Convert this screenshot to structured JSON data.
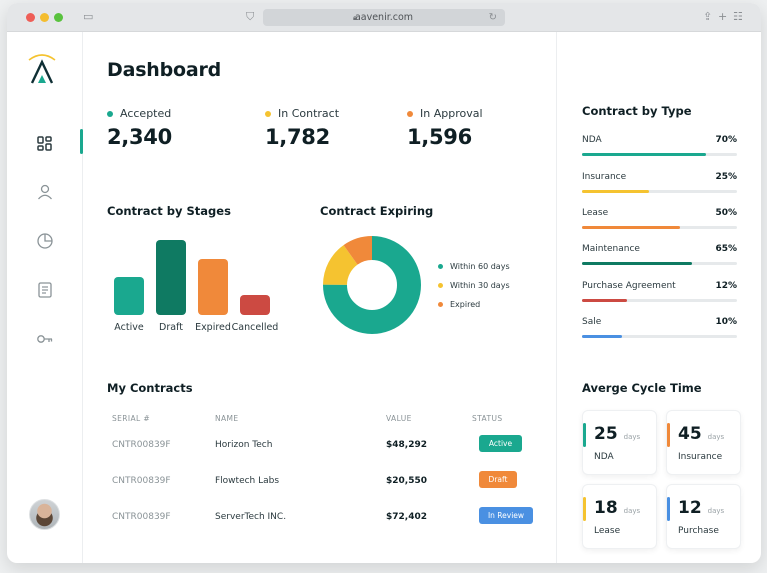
{
  "browser": {
    "url": "aavenir.com"
  },
  "page": {
    "title": "Dashboard"
  },
  "stats": [
    {
      "label": "Accepted",
      "value": "2,340",
      "color": "#1aa88f"
    },
    {
      "label": "In Contract",
      "value": "1,782",
      "color": "#f5c330"
    },
    {
      "label": "In Approval",
      "value": "1,596",
      "color": "#f0893a"
    }
  ],
  "stages": {
    "title": "Contract by Stages",
    "bars": [
      {
        "label": "Active",
        "color": "#1aa88f",
        "level": 0.5
      },
      {
        "label": "Draft",
        "color": "#0f7a62",
        "level": 1.0
      },
      {
        "label": "Expired",
        "color": "#f0893a",
        "level": 0.74
      },
      {
        "label": "Cancelled",
        "color": "#cc4a42",
        "level": 0.26
      }
    ]
  },
  "expiring": {
    "title": "Contract Expiring",
    "legend": [
      {
        "label": "Within 60 days",
        "color": "#1aa88f",
        "share": 0.75
      },
      {
        "label": "Within 30 days",
        "color": "#f5c330",
        "share": 0.15
      },
      {
        "label": "Expired",
        "color": "#f0893a",
        "share": 0.1
      }
    ]
  },
  "contracts": {
    "title": "My Contracts",
    "columns": {
      "serial": "SERIAL #",
      "name": "NAME",
      "value": "VALUE",
      "status": "STATUS"
    },
    "rows": [
      {
        "serial": "CNTR00839F",
        "name": "Horizon Tech",
        "value": "$48,292",
        "status": "Active",
        "status_color": "#1aa88f"
      },
      {
        "serial": "CNTR00839F",
        "name": "Flowtech Labs",
        "value": "$20,550",
        "status": "Draft",
        "status_color": "#f0893a"
      },
      {
        "serial": "CNTR00839F",
        "name": "ServerTech INC.",
        "value": "$72,402",
        "status": "In Review",
        "status_color": "#4a90e2"
      }
    ]
  },
  "contract_type": {
    "title": "Contract  by Type",
    "items": [
      {
        "label": "NDA",
        "pct": "70%",
        "fraction": 0.8,
        "color": "#1aa88f"
      },
      {
        "label": "Insurance",
        "pct": "25%",
        "fraction": 0.43,
        "color": "#f5c330"
      },
      {
        "label": "Lease",
        "pct": "50%",
        "fraction": 0.63,
        "color": "#f0893a"
      },
      {
        "label": "Maintenance",
        "pct": "65%",
        "fraction": 0.71,
        "color": "#0f7a62"
      },
      {
        "label": "Purchase Agreement",
        "pct": "12%",
        "fraction": 0.29,
        "color": "#cc4a42"
      },
      {
        "label": "Sale",
        "pct": "10%",
        "fraction": 0.26,
        "color": "#4a90e2"
      }
    ]
  },
  "cycle": {
    "title": "Averge Cycle Time",
    "unit": "days",
    "cards": [
      {
        "value": "25",
        "label": "NDA",
        "color": "#1aa88f"
      },
      {
        "value": "45",
        "label": "Insurance",
        "color": "#f0893a"
      },
      {
        "value": "18",
        "label": "Lease",
        "color": "#f5c330"
      },
      {
        "value": "12",
        "label": "Purchase",
        "color": "#4a90e2"
      }
    ]
  },
  "icons": {
    "dashboard": "grid-icon",
    "users": "user-icon",
    "reports": "pie-chart-icon",
    "documents": "document-icon",
    "keys": "key-icon"
  }
}
